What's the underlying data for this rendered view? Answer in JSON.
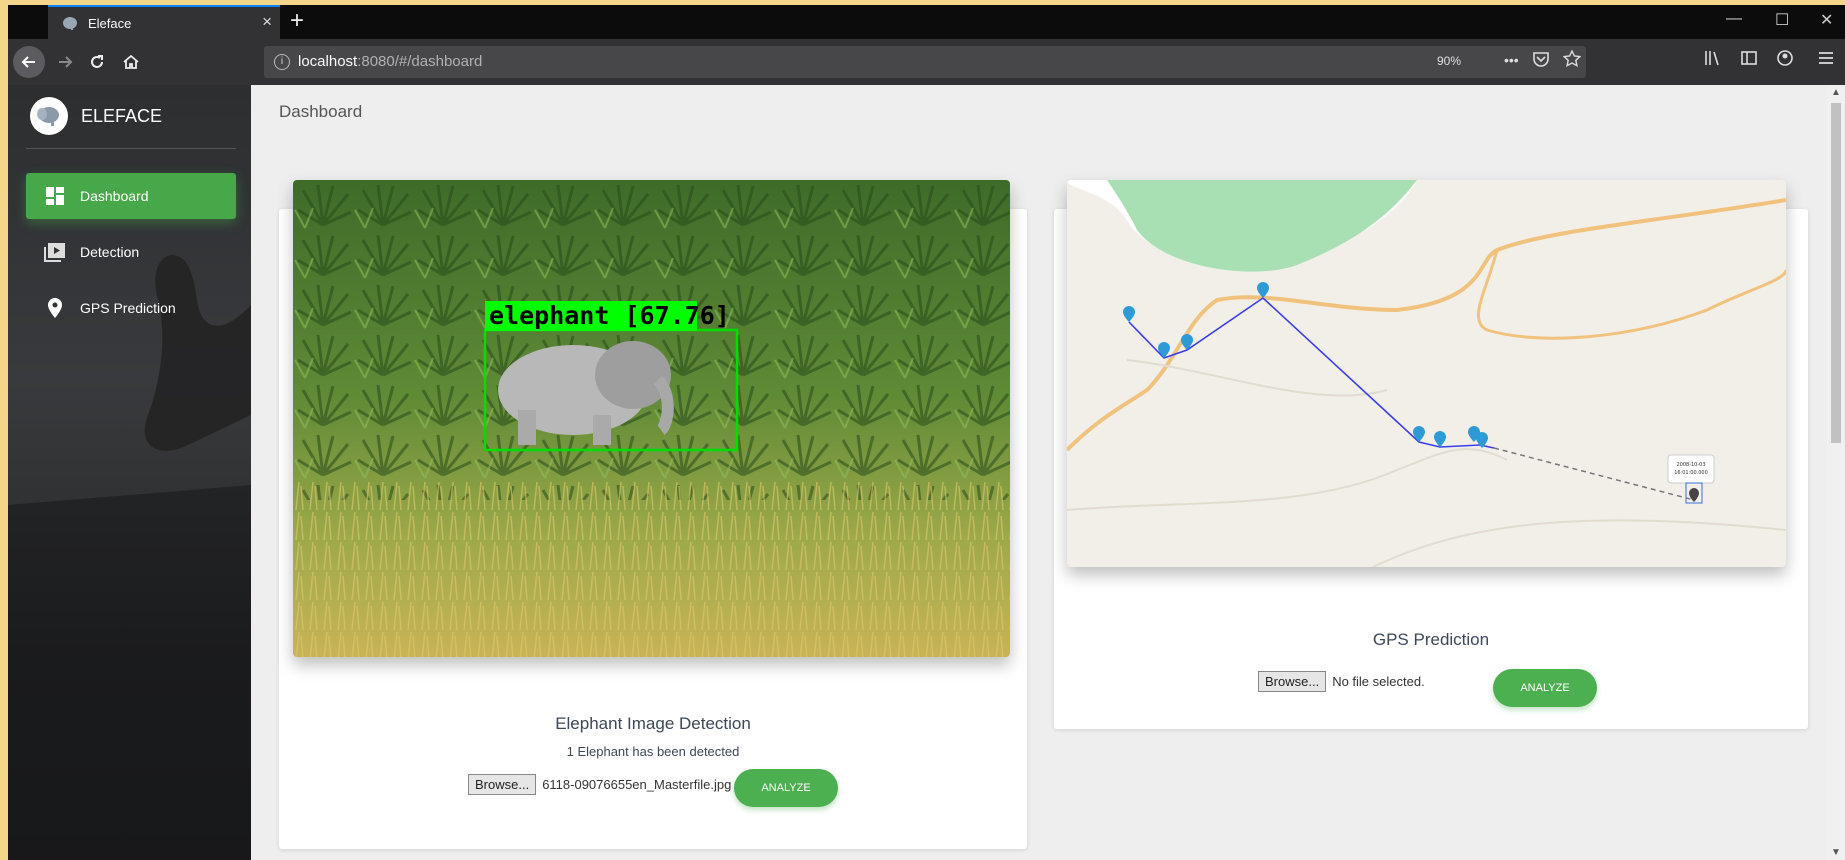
{
  "browser": {
    "tab_title": "Eleface",
    "tab_close": "×",
    "new_tab": "+",
    "url_host": "localhost",
    "url_rest": ":8080/#/dashboard",
    "zoom": "90%",
    "page_actions": "•••",
    "window_controls": {
      "minimize": "—",
      "maximize": "☐",
      "close": "✕"
    }
  },
  "sidebar": {
    "brand": "ELEFACE",
    "items": [
      {
        "label": "Dashboard",
        "icon": "dashboard-icon",
        "active": true
      },
      {
        "label": "Detection",
        "icon": "video-library-icon",
        "active": false
      },
      {
        "label": "GPS Prediction",
        "icon": "location-pin-icon",
        "active": false
      }
    ]
  },
  "page_title": "Dashboard",
  "detection_card": {
    "box_label": "elephant [67.76]",
    "title": "Elephant Image Detection",
    "result": "1 Elephant has been detected",
    "browse_label": "Browse...",
    "file_name": "6118-09076655en_Masterfile.jpg",
    "analyze_label": "ANALYZE"
  },
  "gps_card": {
    "title": "GPS Prediction",
    "browse_label": "Browse...",
    "file_name": "No file selected.",
    "analyze_label": "ANALYZE",
    "popup_text": [
      "2008-10-03",
      "16:01:00.000"
    ],
    "colors": {
      "track": "#3a3df0",
      "marker": "#2f9bd6",
      "water": "#a8e0b4",
      "road": "#f0c27e"
    }
  },
  "colors": {
    "accent": "#4caf50",
    "tab_highlight": "#0a84ff"
  }
}
